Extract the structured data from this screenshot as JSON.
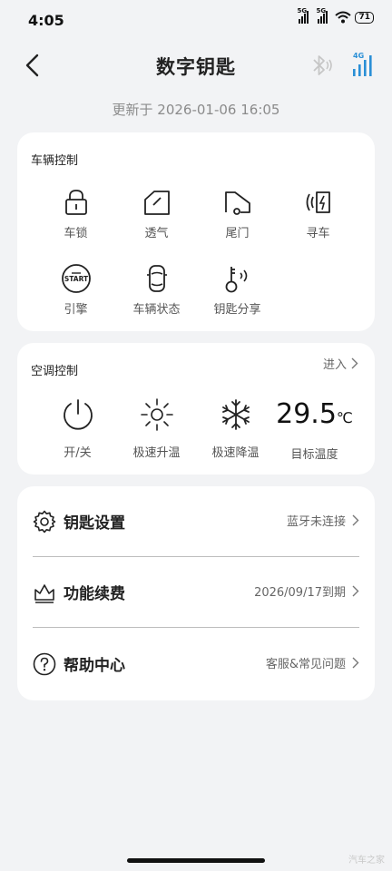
{
  "status_bar": {
    "time": "4:05",
    "signal_tags": [
      "5G",
      "5G"
    ],
    "battery": "71"
  },
  "header": {
    "title": "数字钥匙",
    "updated": "更新于 2026-01-06 16:05",
    "network_tag": "4G"
  },
  "vehicle_control": {
    "title": "车辆控制",
    "items": [
      {
        "label": "车锁",
        "icon": "lock-icon"
      },
      {
        "label": "透气",
        "icon": "window-icon"
      },
      {
        "label": "尾门",
        "icon": "tailgate-icon"
      },
      {
        "label": "寻车",
        "icon": "find-car-icon"
      },
      {
        "label": "引擎",
        "icon": "engine-start-icon"
      },
      {
        "label": "车辆状态",
        "icon": "car-status-icon"
      },
      {
        "label": "钥匙分享",
        "icon": "key-share-icon"
      }
    ]
  },
  "ac_control": {
    "title": "空调控制",
    "enter": "进入",
    "items": [
      {
        "label": "开/关",
        "icon": "power-icon"
      },
      {
        "label": "极速升温",
        "icon": "sun-icon"
      },
      {
        "label": "极速降温",
        "icon": "snowflake-icon"
      }
    ],
    "target_temp": {
      "value": "29.5",
      "unit": "℃",
      "label": "目标温度"
    }
  },
  "settings": [
    {
      "title": "钥匙设置",
      "value": "蓝牙未连接",
      "icon": "gear-icon"
    },
    {
      "title": "功能续费",
      "value": "2026/09/17到期",
      "icon": "crown-icon"
    },
    {
      "title": "帮助中心",
      "value": "客服&常见问题",
      "icon": "help-icon"
    }
  ],
  "watermark": "汽车之家",
  "colors": {
    "accent": "#2a8fd6",
    "background": "#f2f3f5",
    "card": "#ffffff"
  }
}
